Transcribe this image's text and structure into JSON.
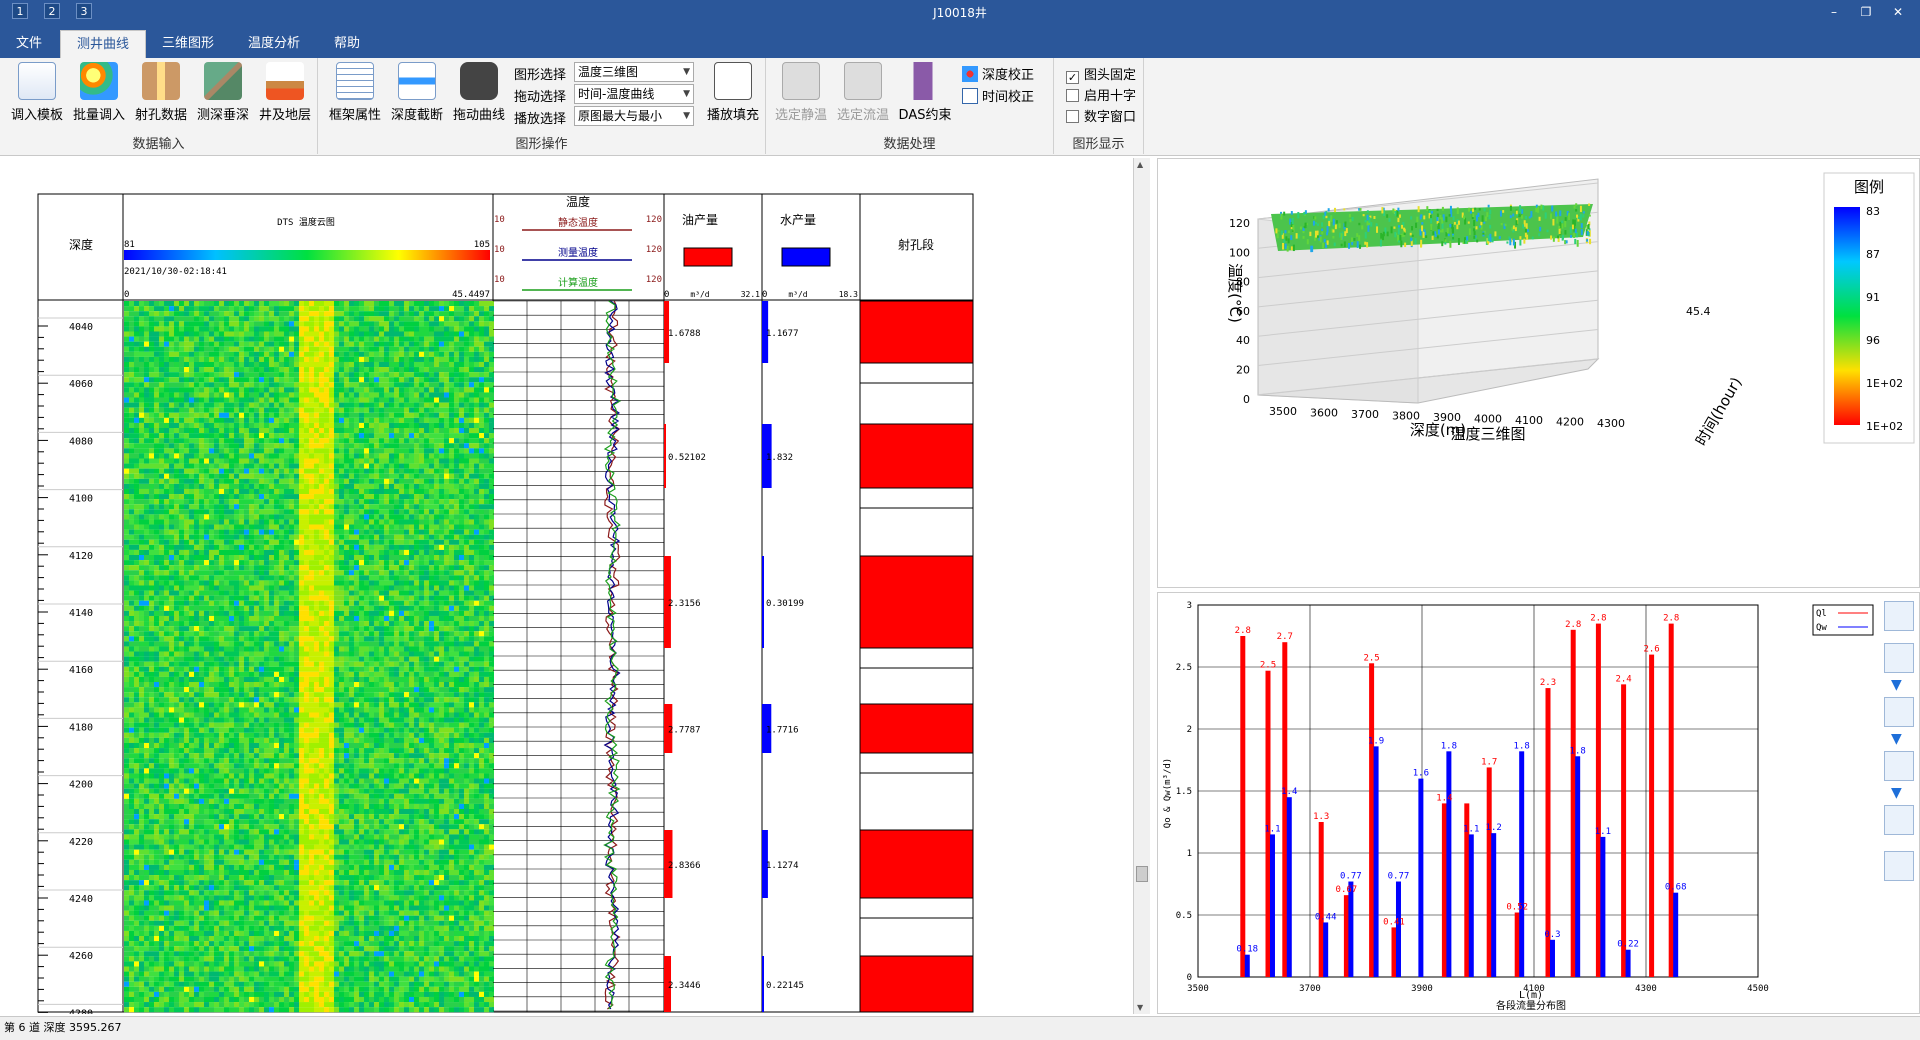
{
  "titlebar": {
    "title": "J10018井",
    "quick_access": [
      "1",
      "2",
      "3"
    ],
    "min": "–",
    "restore": "❐",
    "close": "✕"
  },
  "tabs": [
    {
      "label": "文件"
    },
    {
      "label": "测井曲线"
    },
    {
      "label": "三维图形"
    },
    {
      "label": "温度分析"
    },
    {
      "label": "帮助"
    }
  ],
  "ribbon": {
    "data_input": {
      "label": "数据输入",
      "buttons": [
        "调入模板",
        "批量调入",
        "射孔数据",
        "测深垂深",
        "井及地层"
      ]
    },
    "graph_ops": {
      "label": "图形操作",
      "buttons": [
        "框架属性",
        "深度截断",
        "拖动曲线"
      ],
      "fields": [
        {
          "label": "图形选择",
          "value": "温度三维图"
        },
        {
          "label": "拖动选择",
          "value": "时间-温度曲线"
        },
        {
          "label": "播放选择",
          "value": "原图最大与最小"
        }
      ],
      "play_fill": "播放填充"
    },
    "data_proc": {
      "label": "数据处理",
      "buttons": [
        "选定静温",
        "选定流温",
        "DAS约束"
      ],
      "small": [
        "深度校正",
        "时间校正"
      ]
    },
    "display": {
      "label": "图形显示",
      "checks": [
        {
          "label": "图头固定",
          "checked": true
        },
        {
          "label": "启用十字",
          "checked": false
        },
        {
          "label": "数字窗口",
          "checked": false
        }
      ]
    }
  },
  "log": {
    "depth_header": "深度",
    "dts": {
      "title": "DTS 温度云图",
      "min": "81",
      "max": "105",
      "time": "2021/10/30-02:18:41",
      "scale_min": "0",
      "scale_max": "45.4497"
    },
    "temp": {
      "title": "温度",
      "curves": [
        {
          "name": "静态温度",
          "color": "#8b1a1a"
        },
        {
          "name": "测量温度",
          "color": "#00008b"
        },
        {
          "name": "计算温度",
          "color": "#1a9e1a"
        }
      ],
      "min": "10",
      "max": "120"
    },
    "oil": {
      "title": "油产量",
      "unit": "m³/d",
      "min": "0",
      "max": "32.1"
    },
    "water": {
      "title": "水产量",
      "unit": "m³/d",
      "min": "0",
      "max": "18.3"
    },
    "perf": {
      "title": "射孔段"
    },
    "depth_ticks": [
      "4040",
      "4060",
      "4080",
      "4100",
      "4120",
      "4140",
      "4160",
      "4180",
      "4200",
      "4220",
      "4240",
      "4260",
      "4280"
    ],
    "oil_values": [
      "1.6788",
      "0.52102",
      "2.3156",
      "2.7787",
      "2.8366",
      "2.3446"
    ],
    "water_values": [
      "1.1677",
      "1.832",
      "0.30199",
      "1.7716",
      "1.1274",
      "0.22145"
    ]
  },
  "chart3d": {
    "title": "温度三维图",
    "xlabel": "深度(m)",
    "ylabel": "温度(°C)",
    "zlabel": "时间(hour)",
    "xticks": [
      "3500",
      "3600",
      "3700",
      "3800",
      "3900",
      "4000",
      "4100",
      "4200",
      "4300"
    ],
    "yticks": [
      "120",
      "100",
      "80",
      "60",
      "40",
      "20",
      "0"
    ],
    "ztick": "45.4",
    "legend_title": "图例",
    "legend_ticks": [
      "83",
      "87",
      "91",
      "96",
      "1E+02",
      "1E+02"
    ]
  },
  "chart_data": {
    "type": "bar",
    "title": "各段流量分布图",
    "xlabel": "L(m)",
    "ylabel": "Qo & Qw(m³/d)",
    "xlim": [
      3500,
      4500
    ],
    "ylim": [
      0,
      3
    ],
    "xticks": [
      "3500",
      "3700",
      "3900",
      "4100",
      "4300",
      "4500"
    ],
    "yticks": [
      "0",
      "0.5",
      "1",
      "1.5",
      "2",
      "2.5",
      "3"
    ],
    "series": [
      {
        "name": "Ql",
        "color": "#ff0000",
        "x": [
          3580,
          3625,
          3655,
          3720,
          3765,
          3810,
          3850,
          3940,
          3980,
          4020,
          4070,
          4125,
          4170,
          4215,
          4260,
          4310,
          4345
        ],
        "values": [
          2.75,
          2.47,
          2.7,
          1.25,
          0.66,
          2.53,
          0.4,
          1.4,
          1.4,
          1.69,
          0.52,
          2.33,
          2.8,
          2.85,
          2.36,
          2.6,
          2.85
        ],
        "labels": [
          "2.8",
          "2.5",
          "2.7",
          "1.3",
          "0.67",
          "2.5",
          "0.41",
          "1.4",
          "",
          "1.7",
          "0.52",
          "2.3",
          "2.8",
          "2.8",
          "2.4",
          "2.6",
          "2.8"
        ]
      },
      {
        "name": "Qw",
        "color": "#0000ff",
        "x": [
          3588,
          3633,
          3663,
          3728,
          3773,
          3818,
          3858,
          3898,
          3948,
          3988,
          4028,
          4078,
          4133,
          4178,
          4223,
          4268,
          4318,
          4353
        ],
        "values": [
          0.18,
          1.15,
          1.45,
          0.44,
          0.77,
          1.86,
          0.77,
          1.6,
          1.82,
          1.15,
          1.16,
          1.82,
          0.3,
          1.78,
          1.13,
          0.22,
          0.0,
          0.68
        ],
        "labels": [
          "0.18",
          "1.1",
          "1.4",
          "0.44",
          "0.77",
          "1.9",
          "0.77",
          "1.6",
          "1.8",
          "1.1",
          "1.2",
          "1.8",
          "0.3",
          "1.8",
          "1.1",
          "0.22",
          "",
          "0.68"
        ]
      }
    ]
  },
  "status": "第 6 道 深度 3595.267"
}
